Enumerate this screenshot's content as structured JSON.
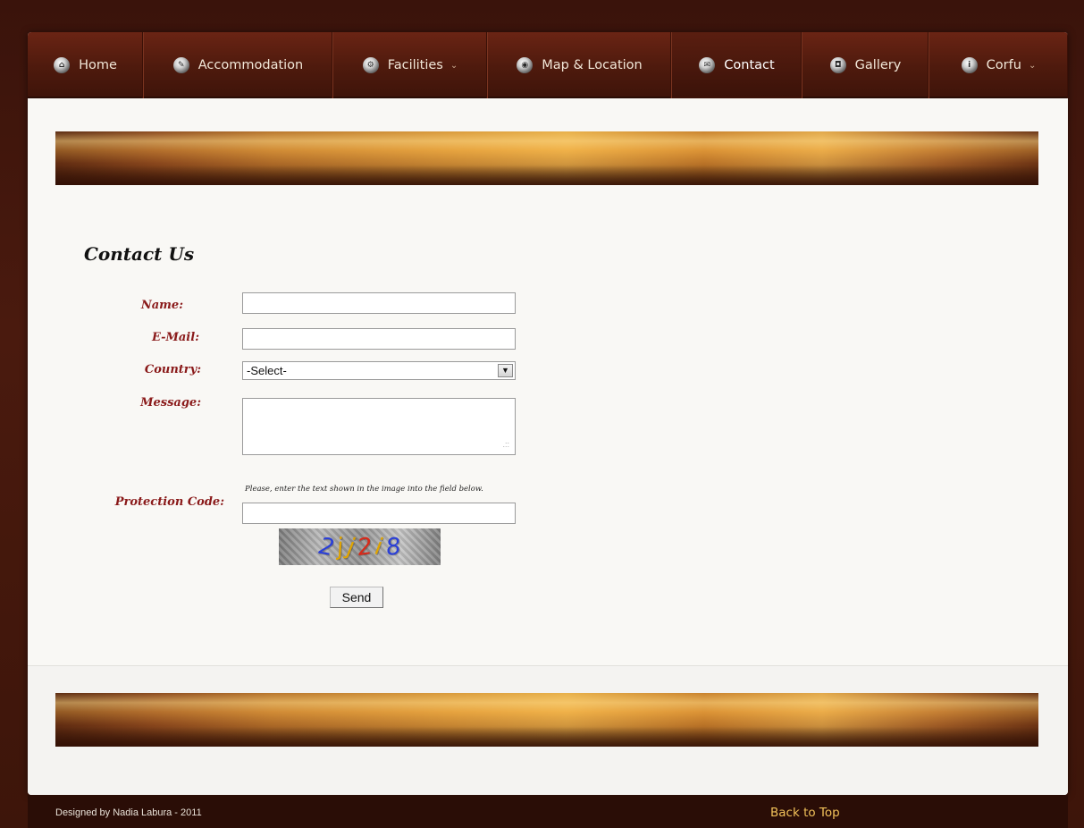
{
  "nav": {
    "items": [
      {
        "label": "Home",
        "icon": "home-icon",
        "glyph": "⌂",
        "has_dropdown": false,
        "active": false
      },
      {
        "label": "Accommodation",
        "icon": "key-icon",
        "glyph": "✎",
        "has_dropdown": false,
        "active": false
      },
      {
        "label": "Facilities",
        "icon": "gear-icon",
        "glyph": "⚙",
        "has_dropdown": true,
        "active": false
      },
      {
        "label": "Map & Location",
        "icon": "globe-icon",
        "glyph": "◉",
        "has_dropdown": false,
        "active": false
      },
      {
        "label": "Contact",
        "icon": "mail-icon",
        "glyph": "✉",
        "has_dropdown": false,
        "active": true
      },
      {
        "label": "Gallery",
        "icon": "camera-icon",
        "glyph": "◘",
        "has_dropdown": false,
        "active": false
      },
      {
        "label": "Corfu",
        "icon": "info-icon",
        "glyph": "i",
        "has_dropdown": true,
        "active": false
      }
    ],
    "dropdown_glyph": "⌄"
  },
  "form": {
    "title": "Contact Us",
    "name_label": "Name:",
    "email_label": "E-Mail:",
    "country_label": "Country:",
    "country_selected": "-Select-",
    "message_label": "Message:",
    "protection_label": "Protection Code:",
    "protection_hint": "Please, enter the text shown in the image into the field below.",
    "captcha_chars": [
      {
        "ch": "2",
        "color": "#2a3fd8"
      },
      {
        "ch": "j",
        "color": "#e0a400"
      },
      {
        "ch": "j",
        "color": "#e0a400"
      },
      {
        "ch": "2",
        "color": "#d72a1a"
      },
      {
        "ch": "i",
        "color": "#e0a400"
      },
      {
        "ch": "8",
        "color": "#2a3fd8"
      }
    ],
    "send_label": "Send"
  },
  "footer": {
    "credit": "Designed by Nadia Labura - 2011",
    "back_to_top": "Back to Top"
  },
  "colors": {
    "label_color": "#8a1a1a",
    "back_to_top_color": "#f2c25a",
    "nav_bg": "#4e1a0d"
  }
}
